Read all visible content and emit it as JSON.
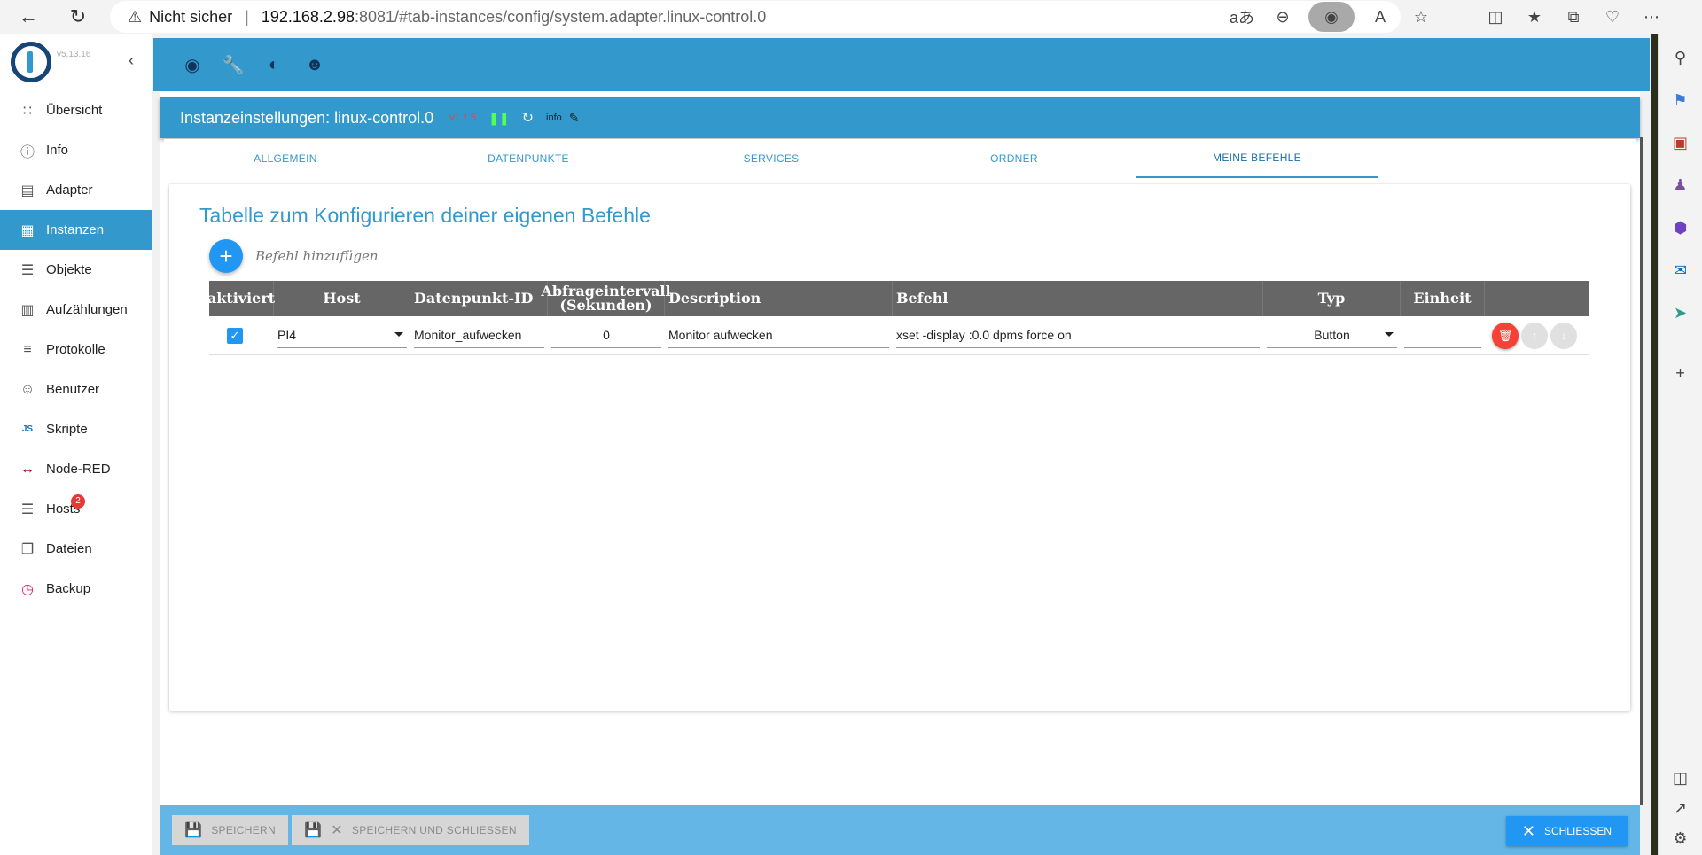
{
  "browser": {
    "security_label": "Nicht sicher",
    "url_host": "192.168.2.98",
    "url_path": ":8081/#tab-instances/config/system.adapter.linux-control.0"
  },
  "sidebar": {
    "version": "v5.13.16",
    "items": [
      {
        "label": "Übersicht",
        "icon": "grid-icon"
      },
      {
        "label": "Info",
        "icon": "info-icon"
      },
      {
        "label": "Adapter",
        "icon": "store-icon"
      },
      {
        "label": "Instanzen",
        "icon": "instances-icon"
      },
      {
        "label": "Objekte",
        "icon": "list-icon"
      },
      {
        "label": "Aufzählungen",
        "icon": "enum-icon"
      },
      {
        "label": "Protokolle",
        "icon": "log-icon"
      },
      {
        "label": "Benutzer",
        "icon": "user-icon"
      },
      {
        "label": "Skripte",
        "icon": "js-icon"
      },
      {
        "label": "Node-RED",
        "icon": "nodered-icon"
      },
      {
        "label": "Hosts",
        "icon": "hosts-icon",
        "badge": "2"
      },
      {
        "label": "Dateien",
        "icon": "files-icon"
      },
      {
        "label": "Backup",
        "icon": "backup-icon"
      }
    ],
    "selected": "Instanzen"
  },
  "instance": {
    "title": "Instanzeinstellungen: linux-control.0",
    "version": "v1.1.5",
    "info_label": "info"
  },
  "tabs": [
    "ALLGEMEIN",
    "DATENPUNKTE",
    "SERVICES",
    "ORDNER",
    "MEINE BEFEHLE"
  ],
  "selected_tab": "MEINE BEFEHLE",
  "panel": {
    "title": "Tabelle zum Konfigurieren deiner eigenen Befehle",
    "add_label": "Befehl hinzufügen"
  },
  "table": {
    "headers": {
      "aktiviert": "aktiviert",
      "host": "Host",
      "datenpunkt": "Datenpunkt-ID",
      "intervall1": "Abfrageintervall",
      "intervall2": "(Sekunden)",
      "description": "Description",
      "befehl": "Befehl",
      "typ": "Typ",
      "einheit": "Einheit"
    },
    "rows": [
      {
        "aktiviert": true,
        "host": "PI4",
        "datenpunkt": "Monitor_aufwecken",
        "intervall": "0",
        "description": "Monitor aufwecken",
        "befehl": "xset -display :0.0 dpms force on",
        "typ": "Button",
        "einheit": ""
      }
    ]
  },
  "footer": {
    "save_label": "SPEICHERN",
    "save_close_label": "SPEICHERN UND SCHLIESSEN",
    "close_label": "SCHLIESSEN"
  }
}
